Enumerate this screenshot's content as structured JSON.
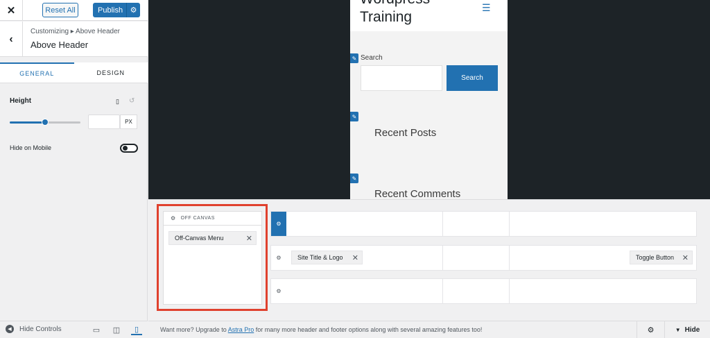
{
  "topbar": {
    "close_glyph": "✕",
    "reset_label": "Reset All",
    "publish_label": "Publish",
    "publish_gear": "⚙"
  },
  "section": {
    "back_glyph": "‹",
    "breadcrumb": "Customizing ▸ Above Header",
    "title": "Above Header"
  },
  "tabs": [
    {
      "label": "GENERAL",
      "active": true
    },
    {
      "label": "DESIGN",
      "active": false
    }
  ],
  "height_control": {
    "label": "Height",
    "device_icon": "mobile-icon",
    "reset_icon": "undo-icon",
    "slider_percent": 0.5,
    "value": "",
    "unit": "PX"
  },
  "hide_on_mobile": {
    "label": "Hide on Mobile",
    "enabled": false
  },
  "footer": {
    "hide_controls_label": "Hide Controls",
    "devices": [
      "desktop-icon",
      "tablet-icon",
      "mobile-icon"
    ],
    "active_device": "mobile"
  },
  "preview": {
    "site_title": "Wordpress Training",
    "search_label": "Search",
    "search_button": "Search",
    "widgets": [
      "Recent Posts",
      "Recent Comments"
    ]
  },
  "builder": {
    "offcanvas_title": "OFF CANVAS",
    "offcanvas_items": [
      "Off-Canvas Menu"
    ],
    "rows": [
      {
        "name": "above",
        "active": true,
        "items": []
      },
      {
        "name": "primary",
        "active": false,
        "left_item": "Site Title & Logo",
        "right_item": "Toggle Button"
      },
      {
        "name": "below",
        "active": false,
        "items": []
      }
    ]
  },
  "status": {
    "upgrade_prefix": "Want more? Upgrade to ",
    "upgrade_link": "Astra Pro",
    "upgrade_suffix": " for many more header and footer options along with several amazing features too!",
    "hide_label": "Hide"
  },
  "colors": {
    "accent": "#2271b1",
    "highlight": "#e0412e",
    "preview_bg": "#1d2327"
  }
}
